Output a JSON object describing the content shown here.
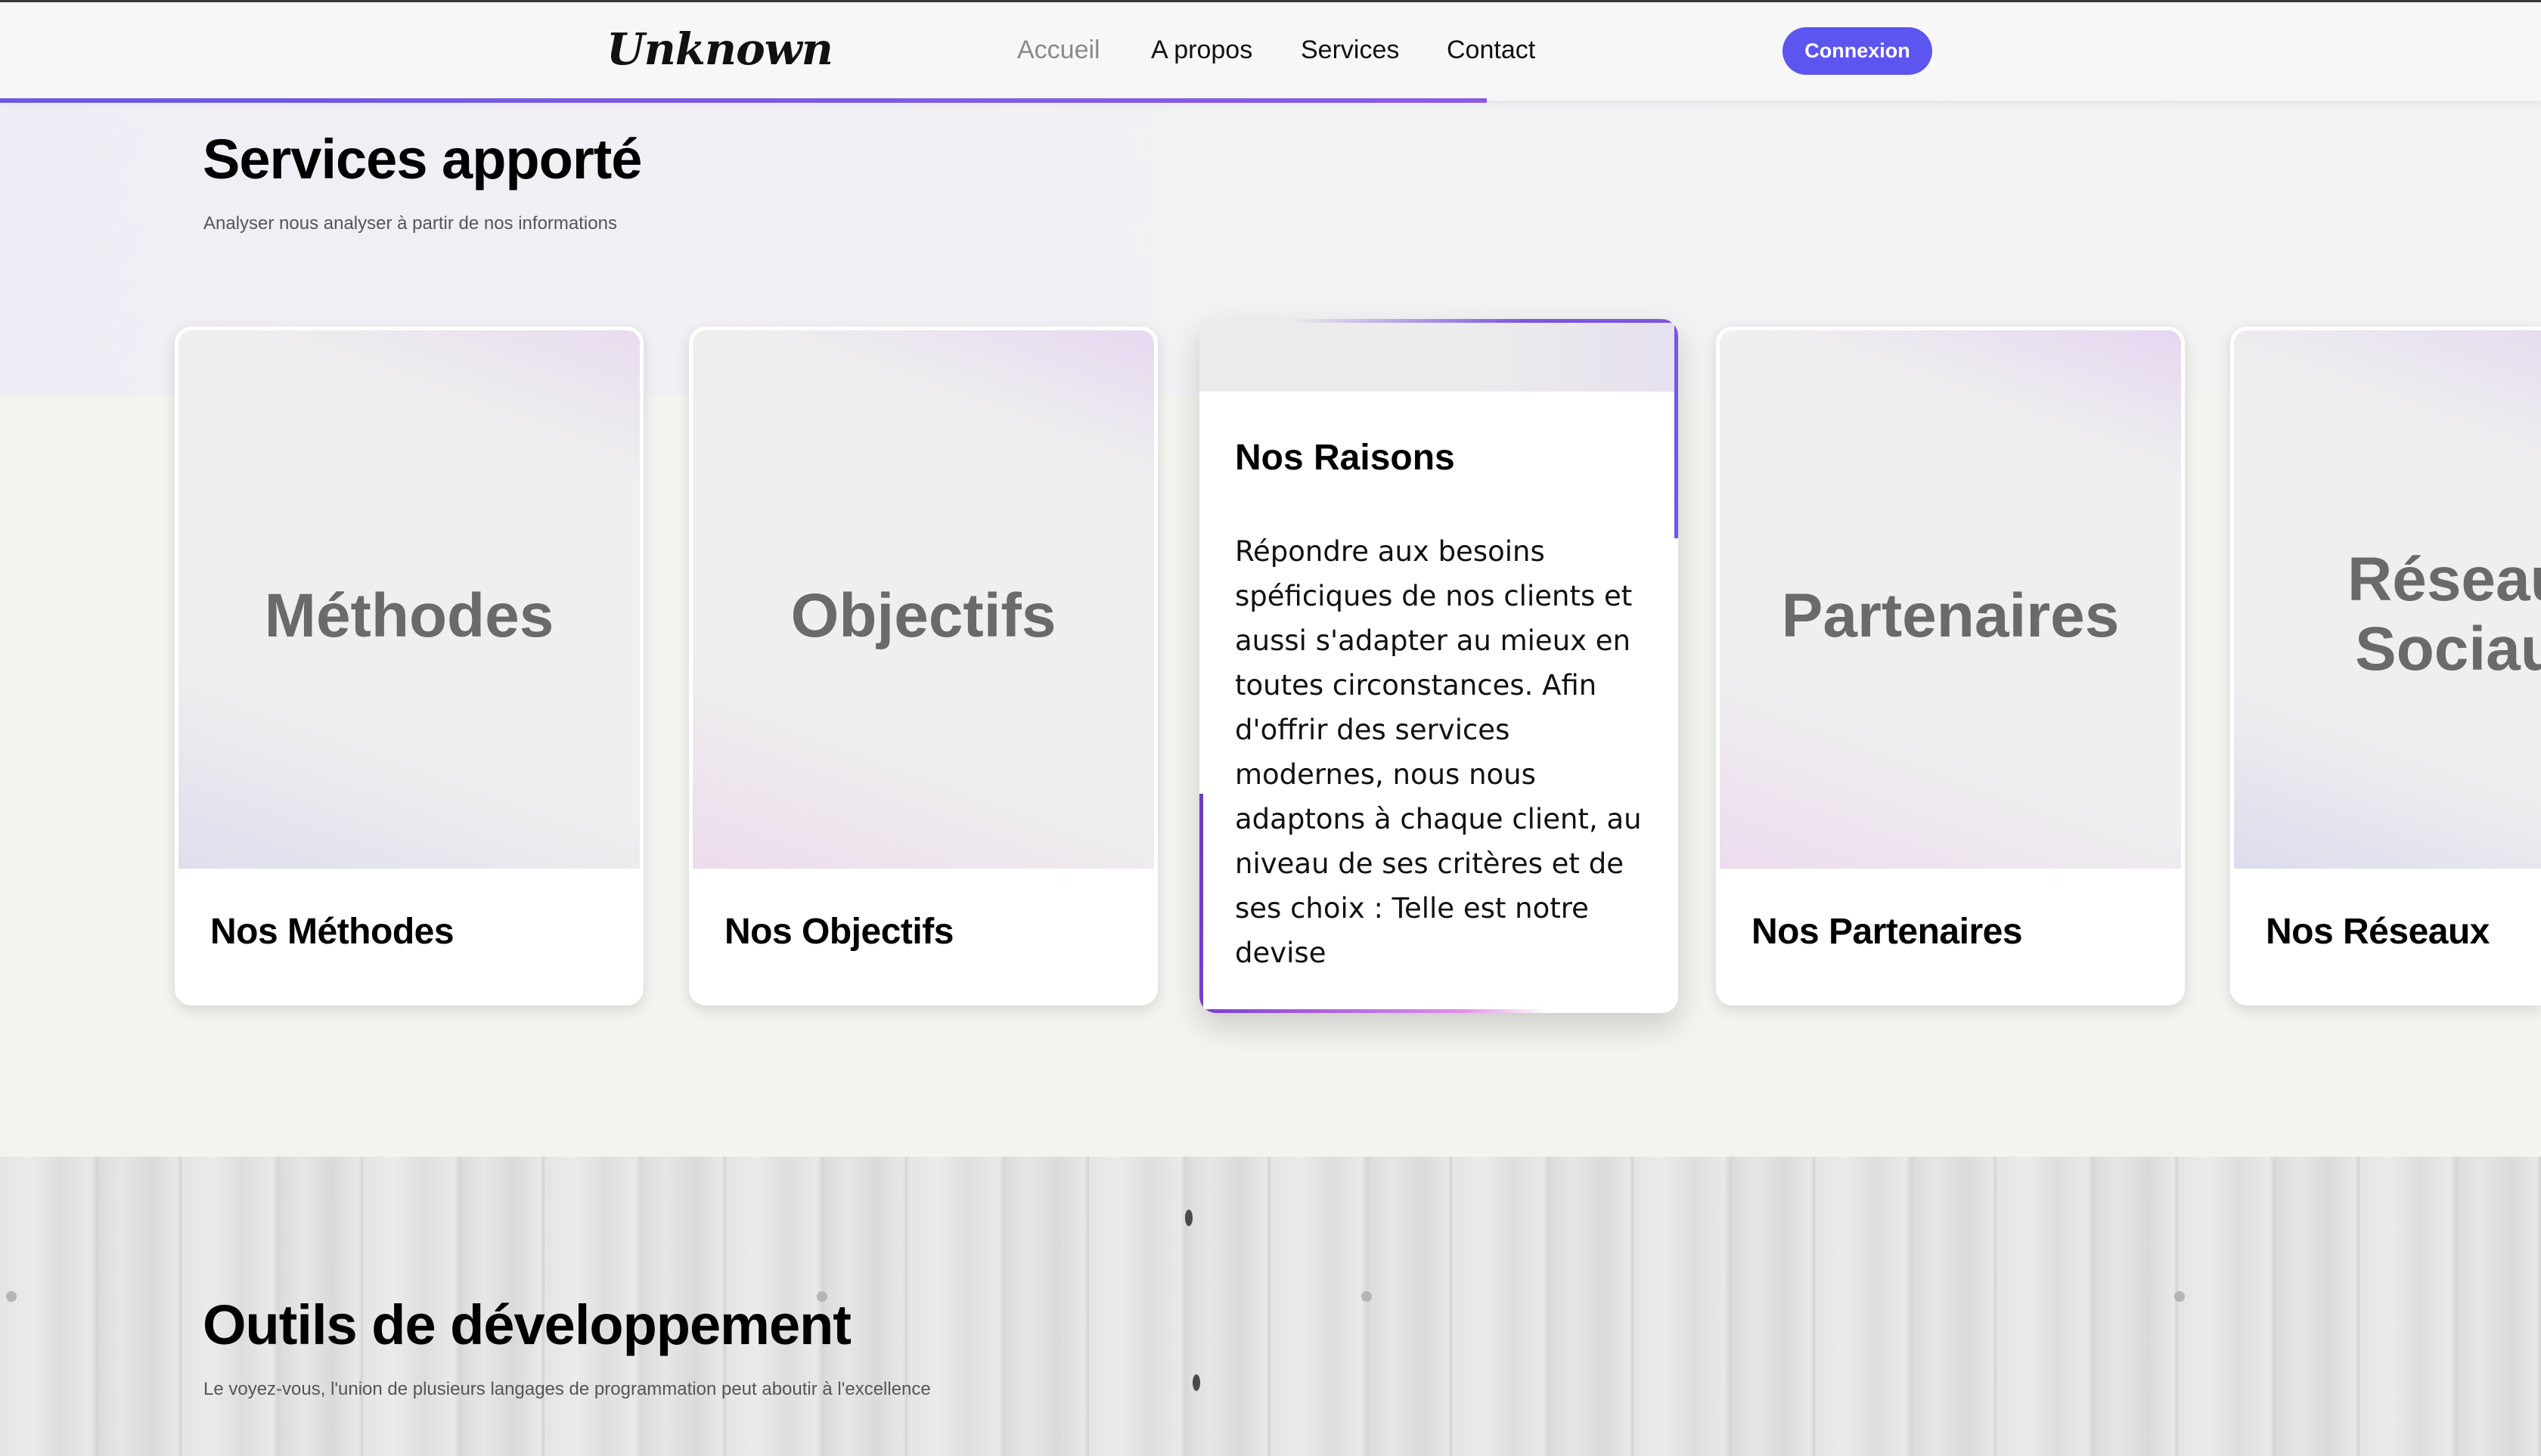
{
  "header": {
    "logo": "Unknown",
    "nav": [
      "Accueil",
      "A propos",
      "Services",
      "Contact"
    ],
    "active_nav": "Accueil",
    "login_label": "Connexion",
    "scroll_progress_percent": 58.5,
    "accent_color": "#5d55f0"
  },
  "services": {
    "title": "Services apporté",
    "subtitle": "Analyser nous analyser à partir de nos informations",
    "cards": [
      {
        "big_label": "Méthodes",
        "caption": "Nos Méthodes"
      },
      {
        "big_label": "Objectifs",
        "caption": "Nos Objectifs"
      },
      {
        "title": "Nos Raisons",
        "description": "Répondre aux besoins spéficiques de nos clients et aussi s'adapter au mieux en toutes circonstances. Afin d'offrir des services modernes, nous nous adaptons à chaque client, au niveau de ses critères et de ses choix : Telle est notre devise"
      },
      {
        "big_label": "Partenaires",
        "caption": "Nos Partenaires"
      },
      {
        "big_label_line1": "Réseau",
        "big_label_line2": "Sociau",
        "caption": "Nos Réseaux"
      }
    ]
  },
  "tools": {
    "title": "Outils de développement",
    "subtitle": "Le voyez-vous, l'union de plusieurs langages de programmation peut aboutir à l'excellence"
  }
}
